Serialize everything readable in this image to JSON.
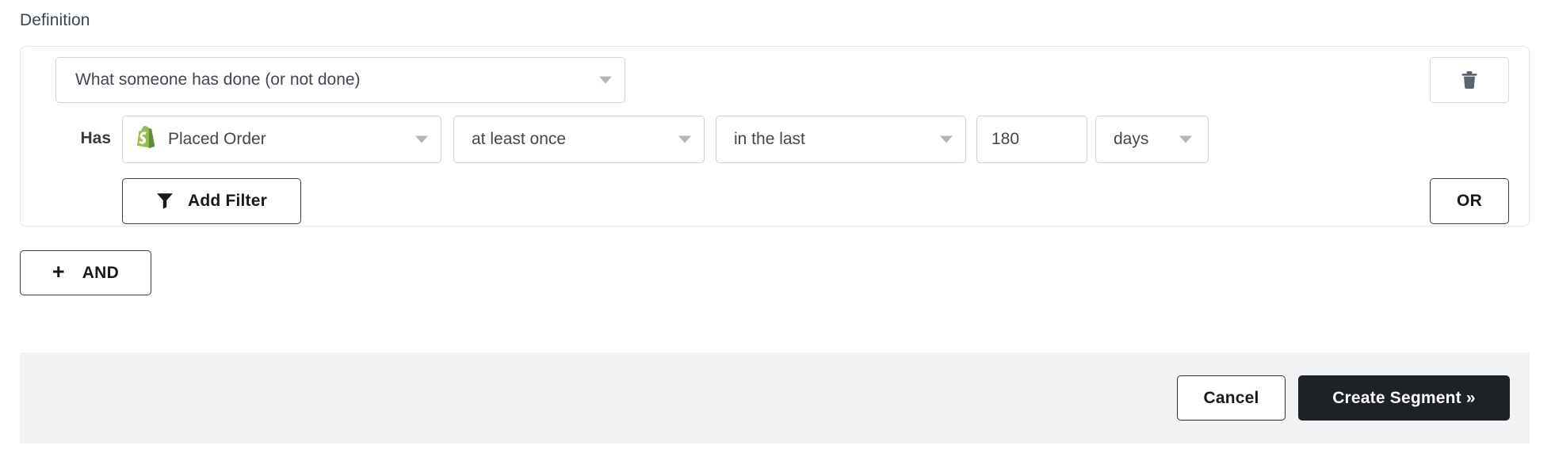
{
  "section": {
    "label": "Definition"
  },
  "condition_group": {
    "type_select": {
      "value": "What someone has done (or not done)",
      "caret_icon": "chevron-down-icon"
    },
    "delete_button": {
      "icon": "trash-icon",
      "title": "Delete"
    },
    "filter": {
      "prefix_label": "Has",
      "metric_select": {
        "value": "Placed Order",
        "source_icon": "shopify-icon",
        "caret_icon": "chevron-down-icon"
      },
      "frequency_select": {
        "value": "at least once",
        "caret_icon": "chevron-down-icon"
      },
      "timeframe_select": {
        "value": "in the last",
        "caret_icon": "chevron-down-icon"
      },
      "duration_input": {
        "value": "180",
        "placeholder": "0"
      },
      "unit_select": {
        "value": "days",
        "caret_icon": "chevron-down-icon"
      }
    },
    "add_filter_button": {
      "label": "Add Filter",
      "icon": "funnel-icon"
    },
    "or_button": {
      "label": "OR"
    }
  },
  "and_button": {
    "plus": "+",
    "label": "AND"
  },
  "footer": {
    "cancel_button": "Cancel",
    "create_button": "Create Segment »"
  },
  "colors": {
    "shopify_green": "#95bf47",
    "shopify_green_dark": "#5e8e3e",
    "primary_dark": "#1e2125",
    "footer_bg": "#f1f2f4",
    "border": "#ccd3d9",
    "text": "#41474f"
  }
}
